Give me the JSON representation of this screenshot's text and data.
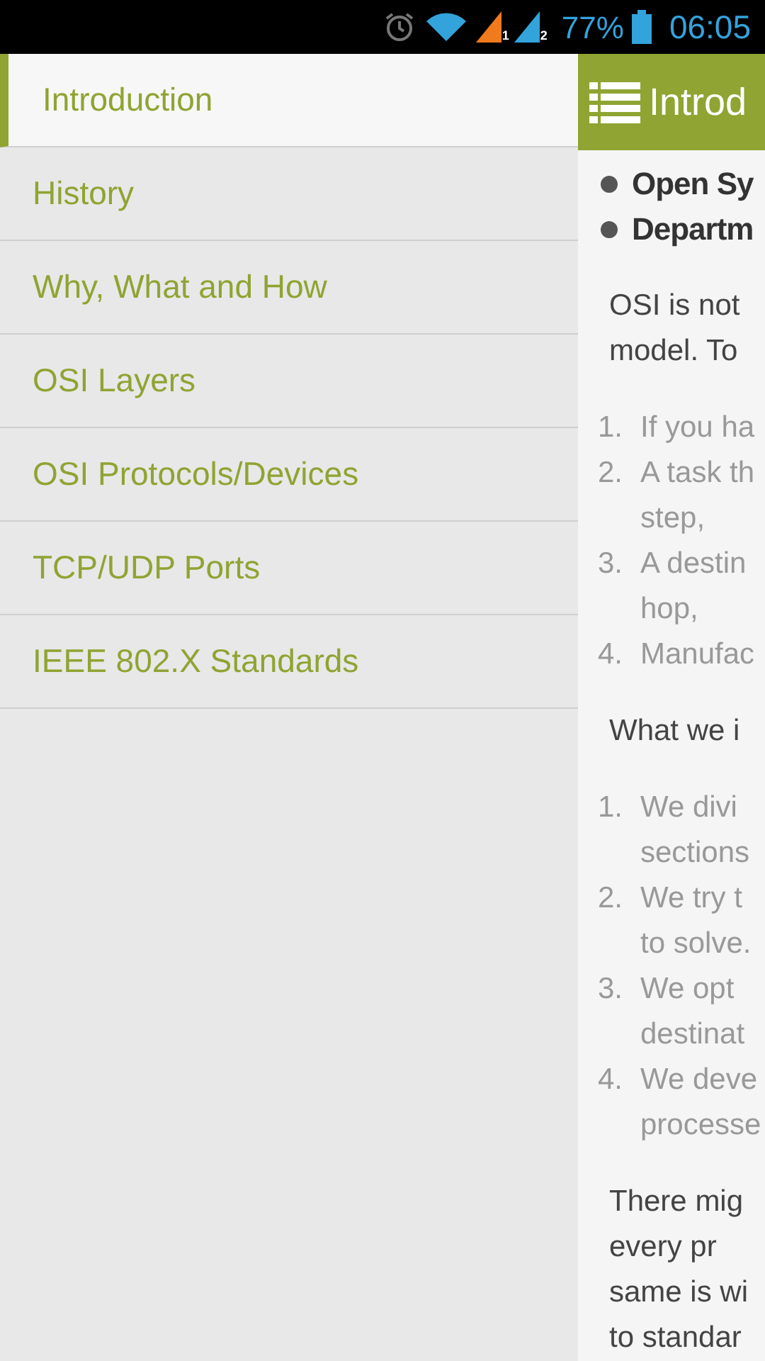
{
  "status_bar": {
    "sim_labels": [
      "1",
      "2"
    ],
    "battery": "77%",
    "time": "06:05"
  },
  "drawer": {
    "items": [
      {
        "label": "Introduction",
        "selected": true
      },
      {
        "label": "History",
        "selected": false
      },
      {
        "label": "Why, What and How",
        "selected": false
      },
      {
        "label": "OSI Layers",
        "selected": false
      },
      {
        "label": "OSI Protocols/Devices",
        "selected": false
      },
      {
        "label": "TCP/UDP Ports",
        "selected": false
      },
      {
        "label": "IEEE 802.X Standards",
        "selected": false
      }
    ]
  },
  "content": {
    "title": "Introd",
    "blocks": [
      {
        "kind": "bullets",
        "items": [
          "Open Sy",
          "Departm"
        ]
      },
      {
        "kind": "paragraph",
        "lines": [
          "OSI is not",
          "model. To"
        ]
      },
      {
        "kind": "ordered",
        "items": [
          {
            "number": "1.",
            "lines": [
              "If you ha"
            ]
          },
          {
            "number": "2.",
            "lines": [
              "A task th",
              "step,"
            ]
          },
          {
            "number": "3.",
            "lines": [
              "A destin",
              "hop,"
            ]
          },
          {
            "number": "4.",
            "lines": [
              "Manufac"
            ]
          }
        ]
      },
      {
        "kind": "paragraph",
        "lines": [
          "What we i"
        ]
      },
      {
        "kind": "ordered",
        "items": [
          {
            "number": "1.",
            "lines": [
              "We divi",
              "sections"
            ]
          },
          {
            "number": "2.",
            "lines": [
              "We try t",
              "to solve."
            ]
          },
          {
            "number": "3.",
            "lines": [
              "We opt",
              "destinat"
            ]
          },
          {
            "number": "4.",
            "lines": [
              "We deve",
              "processe"
            ]
          }
        ]
      },
      {
        "kind": "paragraph",
        "lines": [
          "There mig",
          "every pr",
          "same is wi",
          "to standar"
        ]
      }
    ]
  }
}
